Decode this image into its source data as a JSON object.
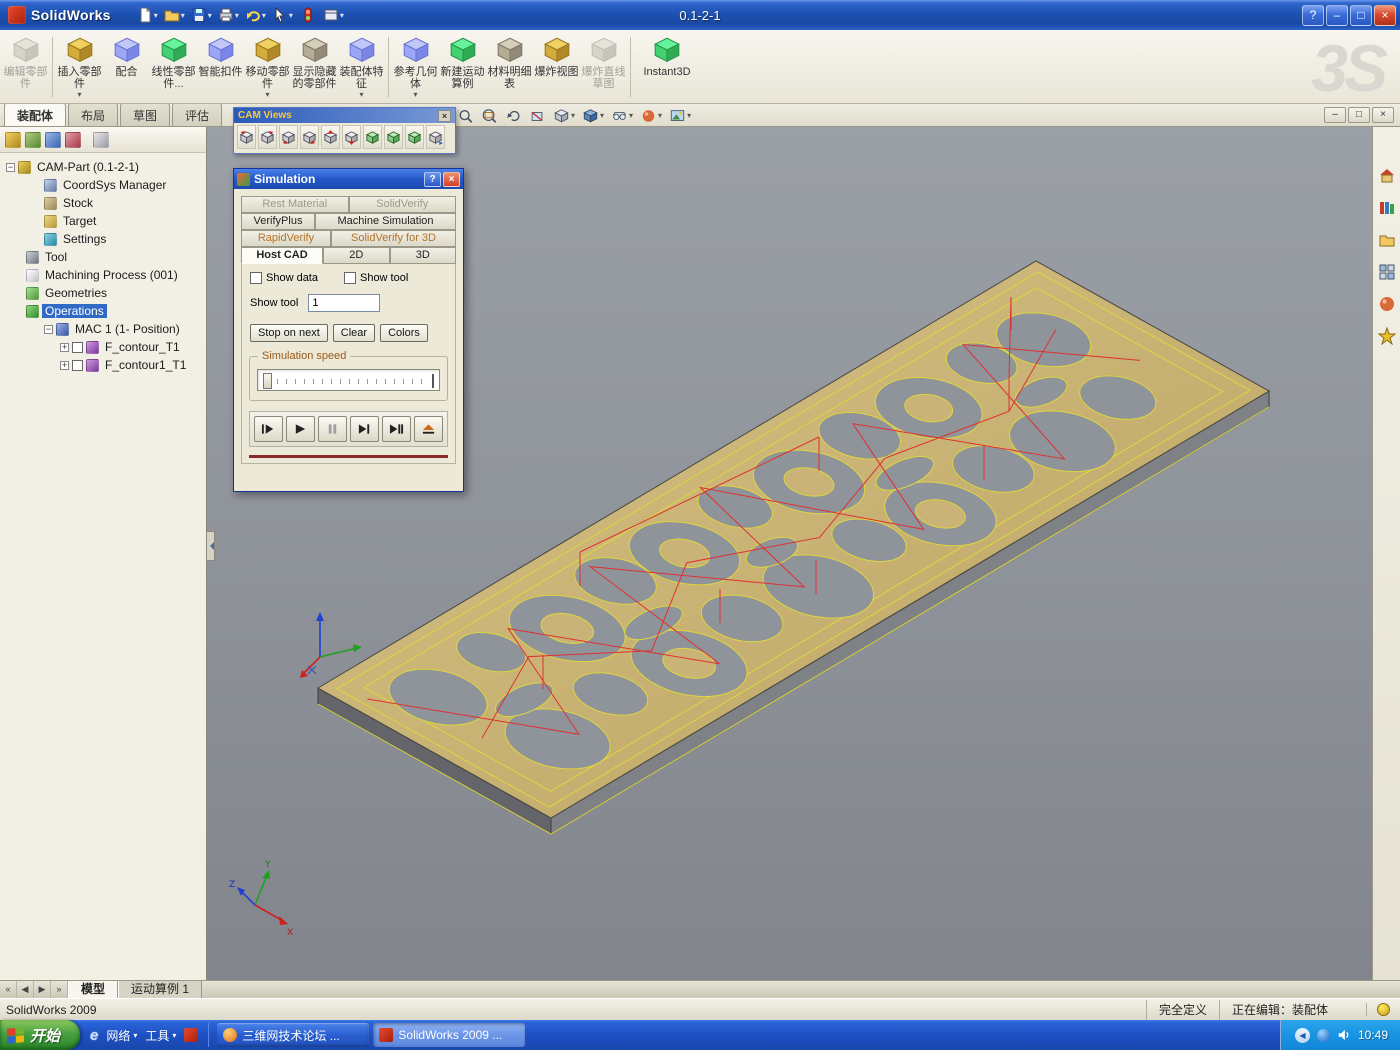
{
  "glyphs": {
    "dropdown": "▾",
    "minus": "−",
    "plus": "+",
    "close": "×",
    "help": "?",
    "minimize": "–",
    "restore": "□",
    "prev": "◀",
    "next": "▶",
    "first": "«",
    "last": "»",
    "ie": "e"
  },
  "colors": {
    "selection": "#316ac5",
    "part_gold": "#c9b377",
    "toolpath_red": "#e03030",
    "contour_yellow": "#ded63f"
  },
  "titlebar": {
    "app_title": "SolidWorks",
    "doc_title": "0.1-2-1"
  },
  "quick_toolbar": {
    "icons": [
      "new-document",
      "open-document",
      "save",
      "print",
      "undo",
      "select",
      "rebuild",
      "view-settings"
    ]
  },
  "ribbon": {
    "watermark": "3S",
    "buttons": [
      {
        "label": "编辑零部件",
        "disabled": true
      },
      {
        "label": "插入零部件",
        "dropdown": true
      },
      {
        "label": "配合"
      },
      {
        "label": "线性零部件..."
      },
      {
        "label": "智能扣件"
      },
      {
        "label": "移动零部件",
        "dropdown": true
      },
      {
        "label": "显示隐藏的零部件"
      },
      {
        "label": "装配体特征",
        "dropdown": true
      },
      {
        "label": "参考几何体",
        "dropdown": true
      },
      {
        "label": "新建运动算例"
      },
      {
        "label": "材料明细表"
      },
      {
        "label": "爆炸视图"
      },
      {
        "label": "爆炸直线草图",
        "disabled": true
      },
      {
        "label": "Instant3D"
      }
    ]
  },
  "command_tabs": [
    {
      "label": "装配体",
      "active": true
    },
    {
      "label": "布局"
    },
    {
      "label": "草图"
    },
    {
      "label": "评估"
    }
  ],
  "view_toolbar": {
    "icons": [
      "zoom-fit",
      "zoom-area",
      "previous-view",
      "section-view",
      "view-orientation",
      "display-style",
      "hide-show-items",
      "edit-appearance",
      "apply-scene"
    ]
  },
  "panel_tabs": {
    "icons": [
      "featuremanager-tab",
      "propertymanager-tab",
      "configurationmanager-tab",
      "dimxpertmanager-tab",
      "displaymanager-tab"
    ]
  },
  "feature_tree": {
    "items": [
      {
        "label": "CAM-Part (0.1-2-1)"
      },
      {
        "label": "CoordSys Manager"
      },
      {
        "label": "Stock"
      },
      {
        "label": "Target"
      },
      {
        "label": "Settings"
      },
      {
        "label": "Tool"
      },
      {
        "label": "Machining Process (001)"
      },
      {
        "label": "Geometries"
      },
      {
        "label": "Operations",
        "selected": true
      },
      {
        "label": "MAC 1 (1- Position)"
      },
      {
        "label": "F_contour_T1",
        "checked": false
      },
      {
        "label": "F_contour1_T1",
        "checked": false
      }
    ]
  },
  "cam_views": {
    "title": "CAM Views",
    "icons": [
      "view-x-plus",
      "view-x-minus",
      "view-y-plus",
      "view-y-minus",
      "view-z-plus",
      "view-z-minus",
      "view-iso-xyz",
      "view-iso-front",
      "view-iso-back",
      "view-cam-home"
    ]
  },
  "simulation": {
    "title": "Simulation",
    "tab_rows": [
      {
        "tabs": [
          {
            "label": "Rest Material",
            "state": "disabled"
          },
          {
            "label": "SolidVerify",
            "state": "disabled"
          }
        ]
      },
      {
        "tabs": [
          {
            "label": "VerifyPlus",
            "state": "normal"
          },
          {
            "label": "Machine Simulation",
            "state": "normal"
          }
        ]
      },
      {
        "tabs": [
          {
            "label": "RapidVerify",
            "state": "accent"
          },
          {
            "label": "SolidVerify for 3D",
            "state": "accent"
          }
        ]
      },
      {
        "tabs": [
          {
            "label": "Host CAD",
            "state": "active"
          },
          {
            "label": "2D",
            "state": "normal"
          },
          {
            "label": "3D",
            "state": "normal"
          }
        ]
      }
    ],
    "show_data_label": "Show data",
    "show_tool_check_label": "Show tool",
    "show_tool_label": "Show tool",
    "show_tool_value": "1",
    "buttons": {
      "stop_on_next": "Stop on next",
      "clear": "Clear",
      "colors": "Colors"
    },
    "speed_group_label": "Simulation speed",
    "transport": [
      "single-step",
      "play",
      "pause",
      "play-to-end",
      "next-operation",
      "eject"
    ]
  },
  "viewport": {
    "triad": {
      "x": "X",
      "y": "Y",
      "z": "Z"
    }
  },
  "task_pane": {
    "icons": [
      "solidworks-resources",
      "design-library",
      "file-explorer",
      "view-palette",
      "appearances",
      "custom-properties"
    ]
  },
  "model_tabs": {
    "tabs": [
      {
        "label": "模型",
        "active": true
      },
      {
        "label": "运动算例 1"
      }
    ]
  },
  "statusbar": {
    "app_version": "SolidWorks 2009",
    "definition_state": "完全定义",
    "editing_state": "正在编辑：装配体"
  },
  "taskbar": {
    "start_label": "开始",
    "toolbars": {
      "network": "网络",
      "tools": "工具"
    },
    "tasks": [
      {
        "label": "三维网技术论坛 ..."
      },
      {
        "label": "SolidWorks 2009 ...",
        "active": true
      }
    ],
    "tray_time": "10:49"
  }
}
